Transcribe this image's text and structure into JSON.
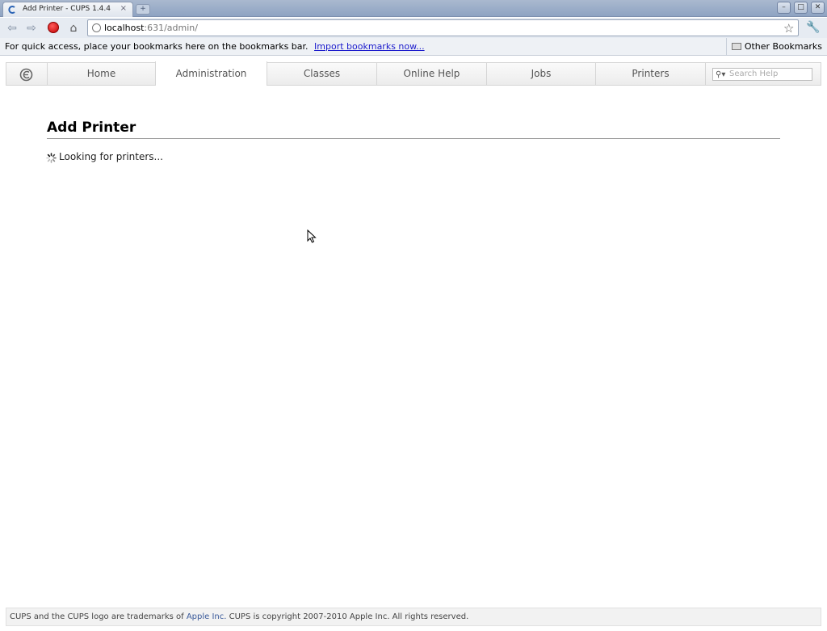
{
  "browser": {
    "tab_title": "Add Printer - CUPS 1.4.4",
    "tab_close": "×",
    "new_tab": "+",
    "window_buttons": [
      "–",
      "□",
      "✕"
    ],
    "url_host": "localhost",
    "url_rest": ":631/admin/",
    "bookmarks_prompt": "For quick access, place your bookmarks here on the bookmarks bar.",
    "import_link": "Import bookmarks now...",
    "other_bookmarks": "Other Bookmarks"
  },
  "cups_nav": {
    "items": [
      "Home",
      "Administration",
      "Classes",
      "Online Help",
      "Jobs",
      "Printers"
    ],
    "active": "Administration",
    "search_placeholder": "Search Help"
  },
  "main": {
    "title": "Add Printer",
    "status_text": "Looking for printers..."
  },
  "footer": {
    "text_before": "CUPS and the CUPS logo are trademarks of ",
    "apple_link": "Apple Inc.",
    "text_after": " CUPS is copyright 2007-2010 Apple Inc. All rights reserved."
  },
  "icons": {
    "back": "back-arrow-icon",
    "forward": "forward-arrow-icon",
    "stop": "stop-icon",
    "home": "home-icon",
    "star": "bookmark-star-icon",
    "wrench": "wrench-icon",
    "spinner": "loading-spinner-icon"
  }
}
